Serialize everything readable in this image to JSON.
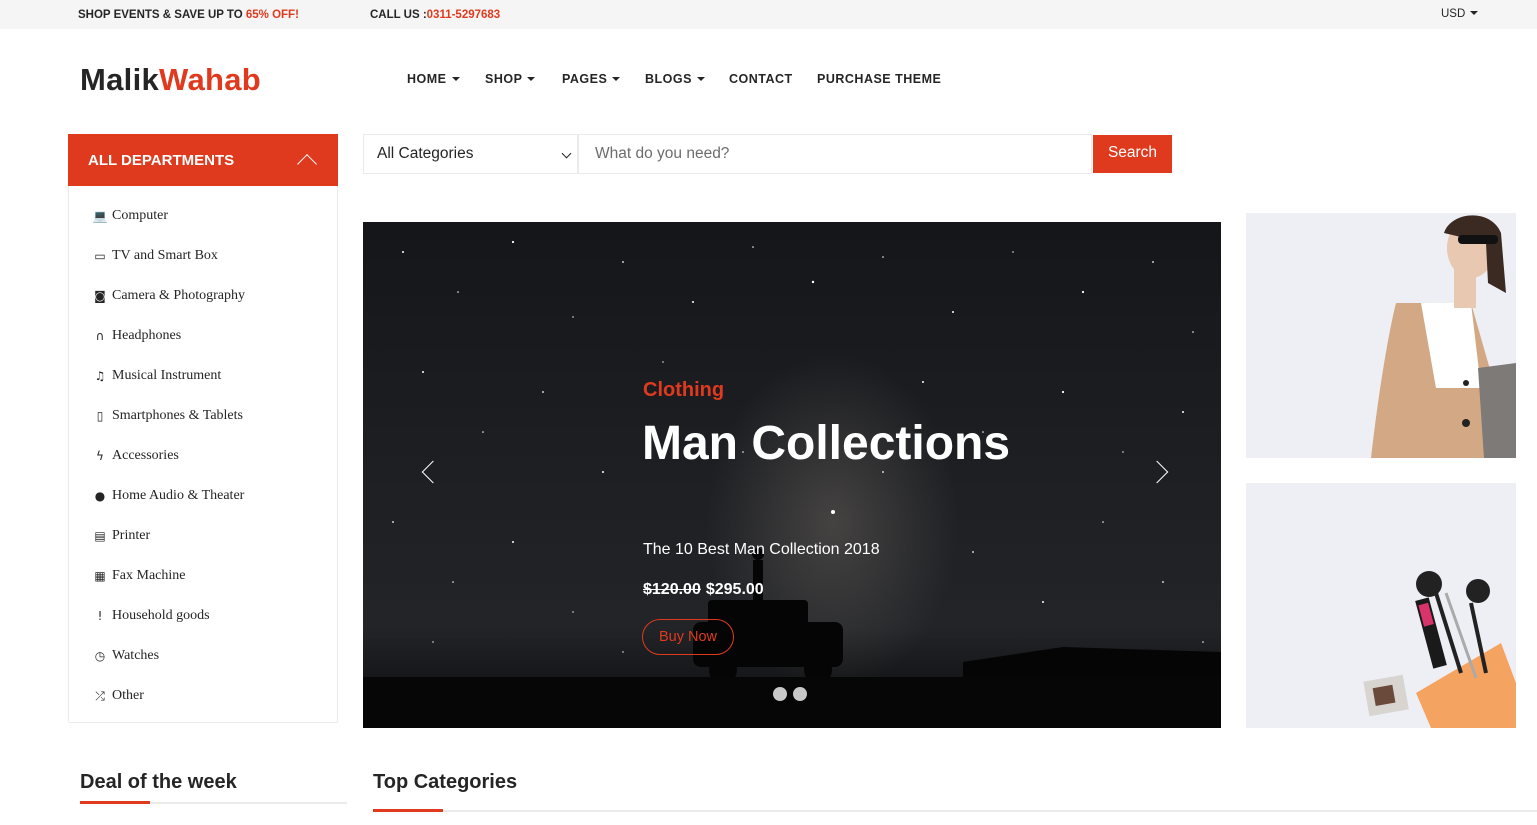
{
  "topbar": {
    "promo_text": "SHOP EVENTS & SAVE UP TO ",
    "promo_highlight": "65% OFF!",
    "call_label": "CALL US :",
    "call_number": "0311-5297683",
    "currency": "USD"
  },
  "logo": {
    "part1": "Malik",
    "part2": "Wahab"
  },
  "nav": {
    "home": "HOME",
    "shop": "SHOP",
    "pages": "PAGES",
    "blogs": "BLOGS",
    "contact": "CONTACT",
    "purchase": "PURCHASE THEME"
  },
  "departments": {
    "title": "ALL DEPARTMENTS",
    "items": [
      {
        "label": "Computer",
        "icon": "laptop-icon"
      },
      {
        "label": "TV and Smart Box",
        "icon": "desktop-icon"
      },
      {
        "label": "Camera & Photography",
        "icon": "camera-icon"
      },
      {
        "label": "Headphones",
        "icon": "headphones-icon"
      },
      {
        "label": "Musical Instrument",
        "icon": "music-icon"
      },
      {
        "label": "Smartphones & Tablets",
        "icon": "mobile-icon"
      },
      {
        "label": "Accessories",
        "icon": "bolt-icon"
      },
      {
        "label": "Home Audio & Theater",
        "icon": "microphone-icon"
      },
      {
        "label": "Printer",
        "icon": "printer-icon"
      },
      {
        "label": "Fax Machine",
        "icon": "fax-icon"
      },
      {
        "label": "Household goods",
        "icon": "thermometer-icon"
      },
      {
        "label": "Watches",
        "icon": "clock-icon"
      },
      {
        "label": "Other",
        "icon": "shuffle-icon"
      }
    ]
  },
  "search": {
    "category_selected": "All Categories",
    "placeholder": "What do you need?",
    "button_label": "Search"
  },
  "hero": {
    "kicker": "Clothing",
    "headline": "Man Collections",
    "subtitle": "The 10 Best Man Collection 2018",
    "old_price": "$120.00",
    "new_price": "$295.00",
    "cta": "Buy Now"
  },
  "sections": {
    "deal_title": "Deal of the week",
    "top_categories_title": "Top Categories"
  },
  "colors": {
    "accent": "#e03a1e",
    "text": "#252525"
  }
}
